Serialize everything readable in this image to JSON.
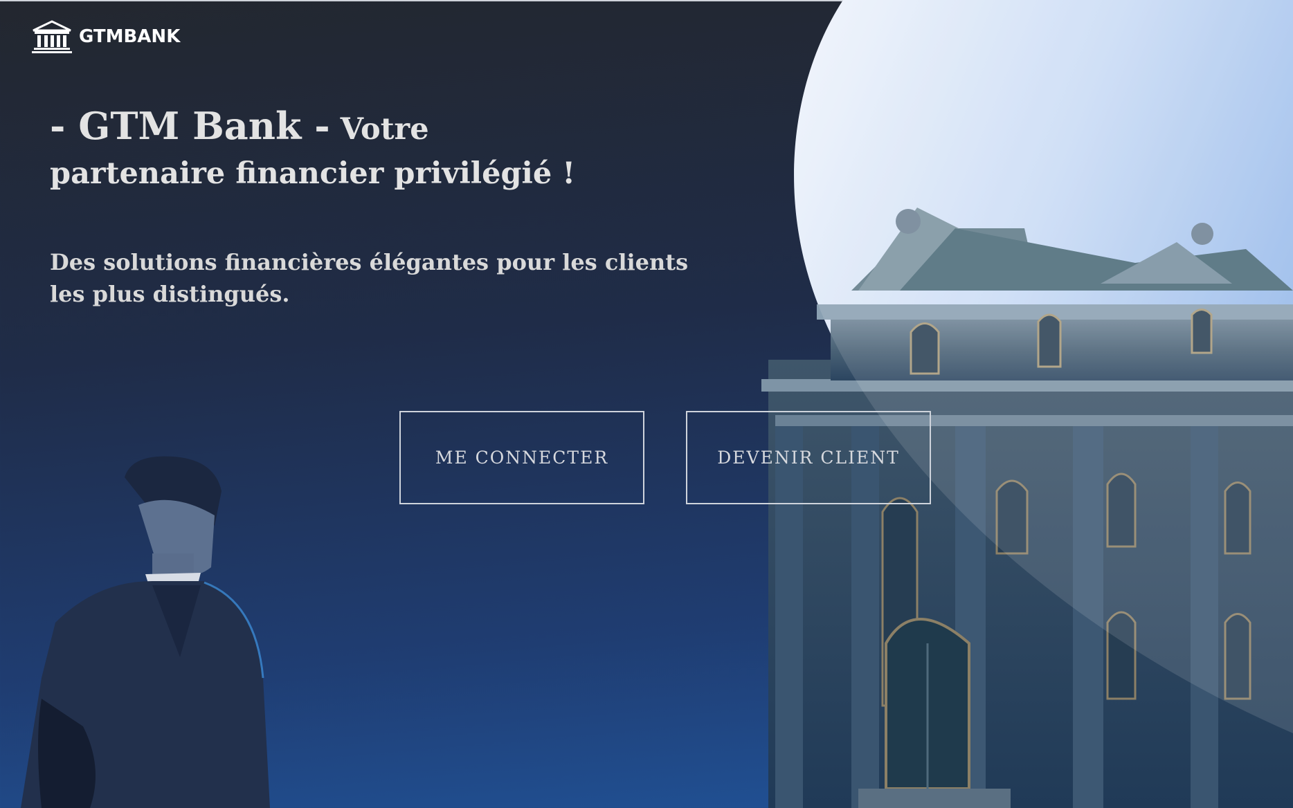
{
  "header": {
    "logo_text": "GTMBANK",
    "logo_icon": "bank-building-icon"
  },
  "hero": {
    "title_brand": "- GTM Bank -",
    "title_rest": "Votre partenaire financier privilégié !",
    "subtitle": "Des solutions financières élégantes pour les clients les plus distingués."
  },
  "actions": {
    "login_label": "ME CONNECTER",
    "register_label": "DEVENIR CLIENT"
  },
  "colors": {
    "background_top": "#23272f",
    "background_bottom": "#21549a",
    "sky_light": "#e8f0fb",
    "sky_blue": "#8fb6ea",
    "text": "#e3e3e3"
  }
}
